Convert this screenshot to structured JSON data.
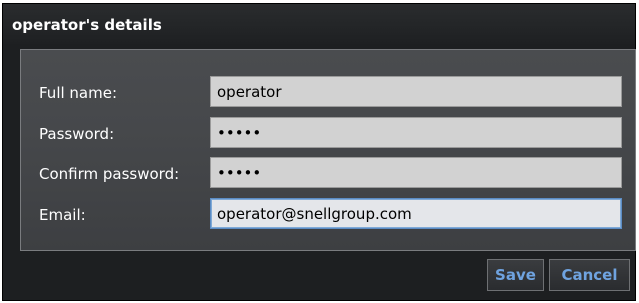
{
  "dialog": {
    "title": "operator's details"
  },
  "form": {
    "fields": [
      {
        "label": "Full name:",
        "value": "operator",
        "type": "text"
      },
      {
        "label": "Password:",
        "value": "passw",
        "type": "password"
      },
      {
        "label": "Confirm password:",
        "value": "passw",
        "type": "password"
      },
      {
        "label": "Email:",
        "value": "operator@snellgroup.com",
        "type": "text"
      }
    ]
  },
  "footer": {
    "save_label": "Save",
    "cancel_label": "Cancel"
  },
  "colors": {
    "button_text": "#6fa3e0",
    "focus_border": "#5b8cc4"
  }
}
